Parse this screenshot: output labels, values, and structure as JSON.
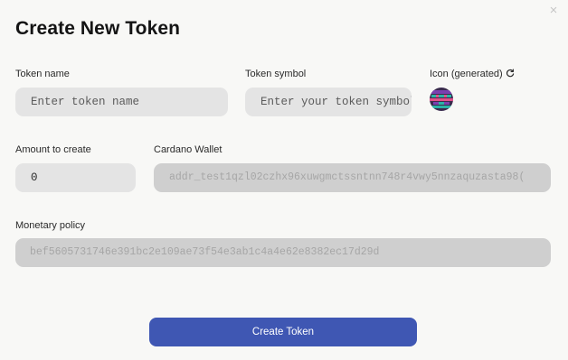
{
  "dialog": {
    "title": "Create New Token",
    "close_glyph": "×"
  },
  "token_name": {
    "label": "Token name",
    "placeholder": "Enter token name",
    "value": ""
  },
  "token_symbol": {
    "label": "Token symbol",
    "placeholder": "Enter your token symbol",
    "value": ""
  },
  "icon": {
    "label": "Icon (generated)",
    "refresh_icon": "refresh-icon",
    "generated_icon": "generated-token-icon",
    "colors": [
      "#3a2a4e",
      "#7a3fb0",
      "#2bb3a6",
      "#e0508a"
    ]
  },
  "amount": {
    "label": "Amount to create",
    "value": "0"
  },
  "wallet": {
    "label": "Cardano Wallet",
    "value": "addr_test1qzl02czhx96xuwgmctssntnn748r4vwy5nnzaquzasta98("
  },
  "policy": {
    "label": "Monetary policy",
    "value": "bef5605731746e391bc2e109ae73f54e3ab1c4a4e62e8382ec17d29d"
  },
  "actions": {
    "create_label": "Create Token"
  },
  "colors": {
    "accent": "#3f57b3",
    "field_bg": "#e4e4e4",
    "readonly_bg": "#cfcfcf",
    "page_bg": "#f8f8f6"
  }
}
